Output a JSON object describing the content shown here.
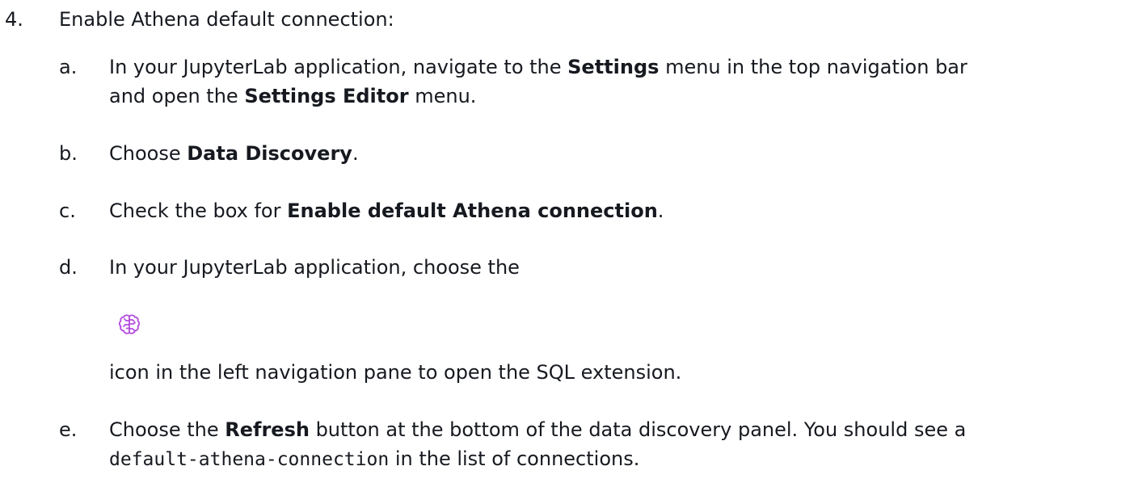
{
  "step": {
    "number": "4.",
    "title": "Enable Athena default connection:"
  },
  "substeps": [
    {
      "letter": "a.",
      "line1_pre": "In your JupyterLab application, navigate to the ",
      "line1_bold": "Settings",
      "line1_post": " menu in the top navigation bar",
      "line2_pre": "and open the ",
      "line2_bold": "Settings Editor",
      "line2_post": " menu."
    },
    {
      "letter": "b.",
      "pre": "Choose ",
      "bold": "Data Discovery",
      "post": "."
    },
    {
      "letter": "c.",
      "pre": "Check the box for ",
      "bold": "Enable default Athena connection",
      "post": "."
    },
    {
      "letter": "d.",
      "line1": "In your JupyterLab application, choose the",
      "icon": "brain-icon",
      "line2": "icon in the left navigation pane to open the SQL extension."
    },
    {
      "letter": "e.",
      "line1_pre": "Choose the ",
      "line1_bold": "Refresh",
      "line1_post": " button at the bottom of the data discovery panel. You should see a",
      "line2_code": "default-athena-connection",
      "line2_post": " in the list of connections."
    }
  ],
  "colors": {
    "text": "#16191f",
    "icon": "#b44ce0"
  }
}
